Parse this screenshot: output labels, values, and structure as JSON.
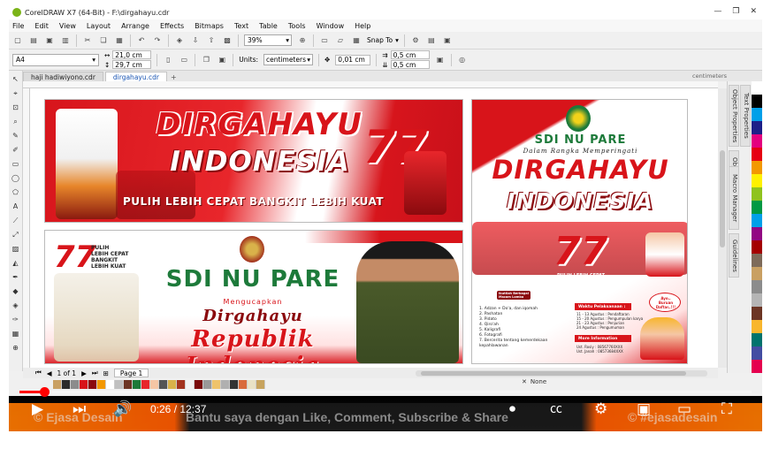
{
  "window": {
    "title": "CorelDRAW X7 (64-Bit) - F:\\dirgahayu.cdr",
    "controls": [
      "—",
      "❐",
      "✕"
    ]
  },
  "menu": [
    "File",
    "Edit",
    "View",
    "Layout",
    "Arrange",
    "Effects",
    "Bitmaps",
    "Text",
    "Table",
    "Tools",
    "Window",
    "Help"
  ],
  "toolbar": {
    "zoom": "39%",
    "snap_to": "Snap To"
  },
  "property_bar": {
    "page_size": "A4",
    "width": "21,0 cm",
    "height": "29,7 cm",
    "units_label": "Units:",
    "units": "centimeters",
    "nudge": "0,01 cm",
    "dup_x": "0,5 cm",
    "dup_y": "0,5 cm"
  },
  "tabs": [
    "haji hadiwiyono.cdr",
    "dirgahayu.cdr"
  ],
  "active_tab": 1,
  "tab_add": "+",
  "ruler_units": "centimeters",
  "docker_tabs": [
    "Object Properties",
    "Text Properties",
    "Object Manager",
    "Macro Manager",
    "Guidelines"
  ],
  "page_nav": {
    "indicator": "1 of 1",
    "page_tab": "Page 1"
  },
  "fill_indicator": "None",
  "colors": {
    "red": "#d8141a",
    "green": "#1d7a3a",
    "accent": "#ff0000"
  },
  "palette": [
    "#ffffff",
    "#000000",
    "#00a0e9",
    "#1d2088",
    "#e4007f",
    "#e60012",
    "#f39800",
    "#fff100",
    "#8fc31f",
    "#009944",
    "#00a0e9",
    "#920783",
    "#a40000",
    "#7e6b5a",
    "#c9a063",
    "#8c8c8c",
    "#b5b5b5",
    "#6c3524",
    "#f8b62d",
    "#00736d",
    "#434da2",
    "#e5004f"
  ],
  "doc_palette": [
    "#c9a063",
    "#2b2b2b",
    "#8c8c8c",
    "#d8141a",
    "#8b0a0e",
    "#f39800",
    "#ffffff",
    "#c0c0c0",
    "#6c3524",
    "#1d7a3a",
    "#e8262b",
    "#f5c6a5",
    "#555555",
    "#d9b24a",
    "#a3331e",
    "#f2f2f2",
    "#7a0b0b",
    "#999999",
    "#efc36b",
    "#b0b0b0",
    "#333333",
    "#d96b3a",
    "#e9e2c6",
    "#c7a35e"
  ],
  "banner1": {
    "line1": "DIRGAHAYU",
    "line2": "INDONESIA",
    "number": "77",
    "tagline": "PULIH LEBIH CEPAT BANGKIT LEBIH KUAT"
  },
  "banner2": {
    "number": "77",
    "logo_text": [
      "PULIH",
      "LEBIH CEPAT",
      "BANGKIT",
      "LEBIH KUAT"
    ],
    "school": "SDI NU PARE",
    "mengucapkan": "Mengucapkan",
    "dirgahayu": "Dirgahayu",
    "republik": "Republik Indonesia"
  },
  "banner3": {
    "school": "SDI NU PARE",
    "subtitle": "Dalam Rangka Memperingati",
    "line1": "DIRGAHAYU",
    "line2": "INDONESIA",
    "number": "77",
    "tagline1": "PULIH LEBIH CEPAT",
    "tagline2": "BANGKIT LEBIH KUAT",
    "lomba_header": "Ikutilah Berbagai Macam Lomba",
    "events": [
      "1. Adzan + Do'a, dan iqomah",
      "2. Pashatan",
      "3. Pidato",
      "4. Qiro'ah",
      "5. Kaligrafi",
      "6. Fotografi",
      "7. Bercerita tentang kemerdekaan",
      "   kepahlawanan"
    ],
    "waktu_header": "Waktu Pelaksanaan :",
    "schedule": [
      "11 - 13 Agustus : Pendaftaran",
      "15 - 20 Agustus : Pengumpulan karya",
      "21 - 23 Agustus : Penjurian",
      "24 Agustus      : Pengumuman"
    ],
    "info_header": "More Information",
    "contacts": [
      "Ust. Rosiy : 08567760XXX",
      "Ust. Janah : 08573684XXX"
    ],
    "bubble": "Ayo.. Buruan Daftar..!!!"
  },
  "player": {
    "time": "0:26 / 12:37",
    "progress_fraction": 0.034,
    "ticker": [
      "© Ejasa Desain",
      "Bantu saya dengan Like, Comment, Subscribe & Share",
      "© #ejasadesain"
    ]
  }
}
